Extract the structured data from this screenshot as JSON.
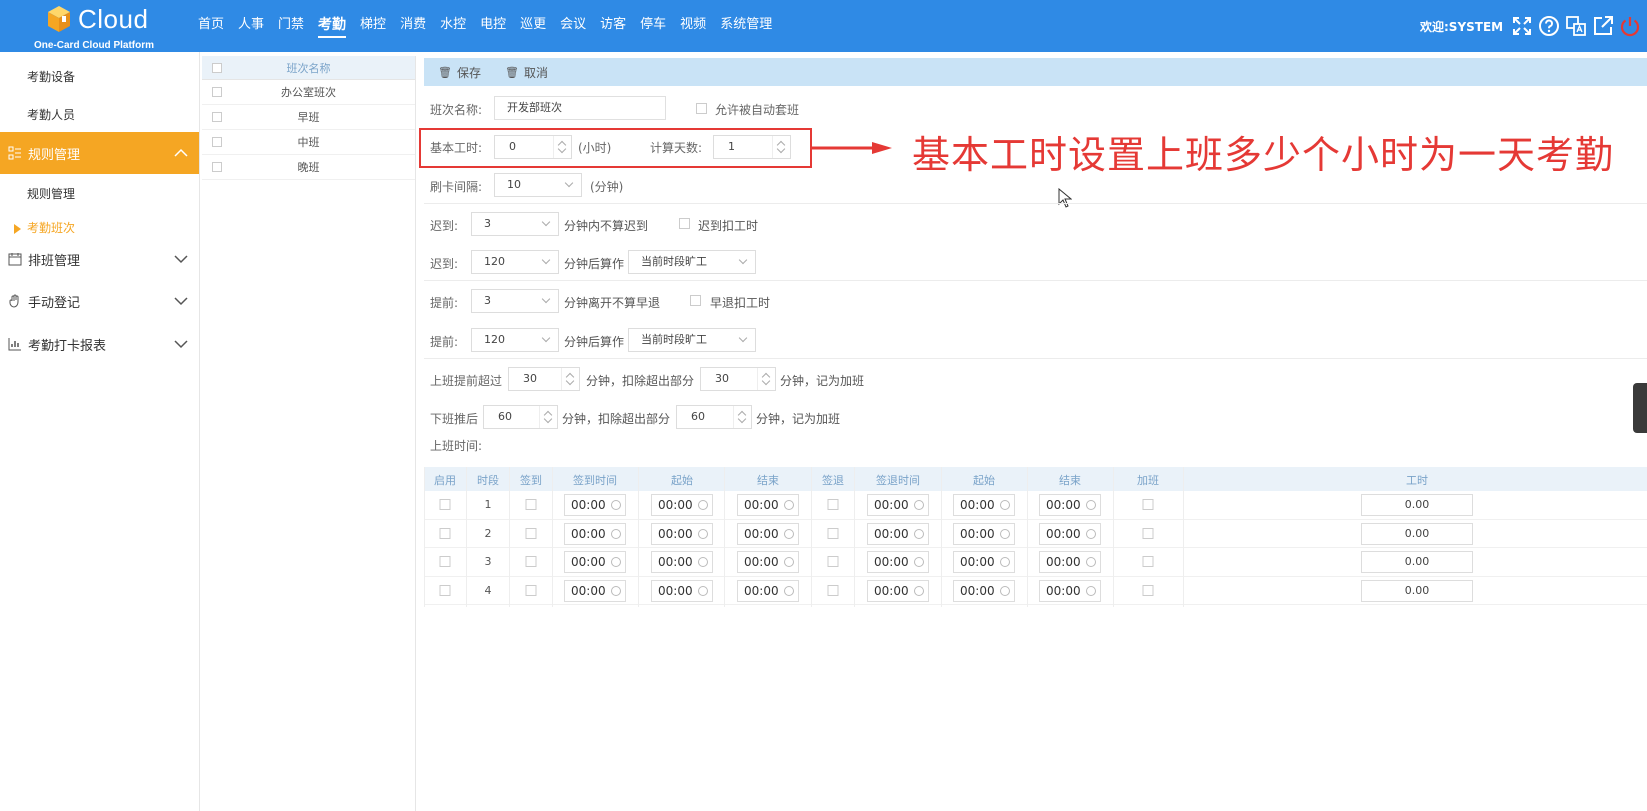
{
  "brand": {
    "name": "Cloud",
    "subtitle": "One-Card Cloud Platform",
    "color": "#2f8ae5"
  },
  "nav": {
    "items": [
      "首页",
      "人事",
      "门禁",
      "考勤",
      "梯控",
      "消费",
      "水控",
      "电控",
      "巡更",
      "会议",
      "访客",
      "停车",
      "视频",
      "系统管理"
    ],
    "active": "考勤"
  },
  "header": {
    "welcome": "欢迎:SYSTEM",
    "icons": [
      "fullscreen-icon",
      "help-icon",
      "translate-icon",
      "external-link-icon",
      "power-icon"
    ]
  },
  "sidebar": {
    "sub_top": [
      "考勤设备",
      "考勤人员"
    ],
    "groups": [
      {
        "label": "规则管理",
        "icon": "rules-icon",
        "expanded": true
      },
      {
        "label": "排班管理",
        "icon": "calendar-icon",
        "expanded": false
      },
      {
        "label": "手动登记",
        "icon": "hand-icon",
        "expanded": false
      },
      {
        "label": "考勤打卡报表",
        "icon": "chart-icon",
        "expanded": false
      }
    ],
    "rule_children": [
      "规则管理",
      "考勤班次"
    ],
    "active_item": "考勤班次",
    "accent": "#f5a623"
  },
  "shift_list": {
    "header": "班次名称",
    "rows": [
      "办公室班次",
      "早班",
      "中班",
      "晚班"
    ]
  },
  "toolbar": {
    "save": "保存",
    "cancel": "取消"
  },
  "form": {
    "shift_name_label": "班次名称:",
    "shift_name_value": "开发部班次",
    "auto_apply_label": "允许被自动套班",
    "base_hours_label": "基本工时:",
    "base_hours_value": "0",
    "base_hours_unit": "(小时)",
    "calc_days_label": "计算天数:",
    "calc_days_value": "1",
    "swipe_interval_label": "刷卡间隔:",
    "swipe_interval_value": "10",
    "swipe_interval_unit": "(分钟)",
    "late_label": "迟到:",
    "late_value": "3",
    "late_text": "分钟内不算迟到",
    "late_deduct_label": "迟到扣工时",
    "late2_label": "迟到:",
    "late2_value": "120",
    "late2_text": "分钟后算作",
    "late2_select": "当前时段旷工",
    "early_label": "提前:",
    "early_value": "3",
    "early_text": "分钟离开不算早退",
    "early_deduct_label": "早退扣工时",
    "early2_label": "提前:",
    "early2_value": "120",
    "early2_text": "分钟后算作",
    "early2_select": "当前时段旷工",
    "ot_before_label": "上班提前超过",
    "ot_before_value": "30",
    "ot_before_text": "分钟，扣除超出部分",
    "ot_before_value2": "30",
    "ot_before_text2": "分钟，记为加班",
    "ot_after_label": "下班推后",
    "ot_after_value": "60",
    "ot_after_text": "分钟，扣除超出部分",
    "ot_after_value2": "60",
    "ot_after_text2": "分钟，记为加班",
    "work_time_label": "上班时间:"
  },
  "annotation": {
    "text": "基本工时设置上班多少个小时为一天考勤",
    "color": "#e53935"
  },
  "time_table": {
    "headers": [
      "启用",
      "时段",
      "签到",
      "签到时间",
      "起始",
      "结束",
      "签退",
      "签退时间",
      "起始",
      "结束",
      "加班",
      "工时"
    ],
    "rows": [
      {
        "period": "1",
        "checkin_time": "00:00",
        "start1": "00:00",
        "end1": "00:00",
        "checkout_time": "00:00",
        "start2": "00:00",
        "end2": "00:00",
        "hours": "0.00"
      },
      {
        "period": "2",
        "checkin_time": "00:00",
        "start1": "00:00",
        "end1": "00:00",
        "checkout_time": "00:00",
        "start2": "00:00",
        "end2": "00:00",
        "hours": "0.00"
      },
      {
        "period": "3",
        "checkin_time": "00:00",
        "start1": "00:00",
        "end1": "00:00",
        "checkout_time": "00:00",
        "start2": "00:00",
        "end2": "00:00",
        "hours": "0.00"
      },
      {
        "period": "4",
        "checkin_time": "00:00",
        "start1": "00:00",
        "end1": "00:00",
        "checkout_time": "00:00",
        "start2": "00:00",
        "end2": "00:00",
        "hours": "0.00"
      }
    ]
  }
}
